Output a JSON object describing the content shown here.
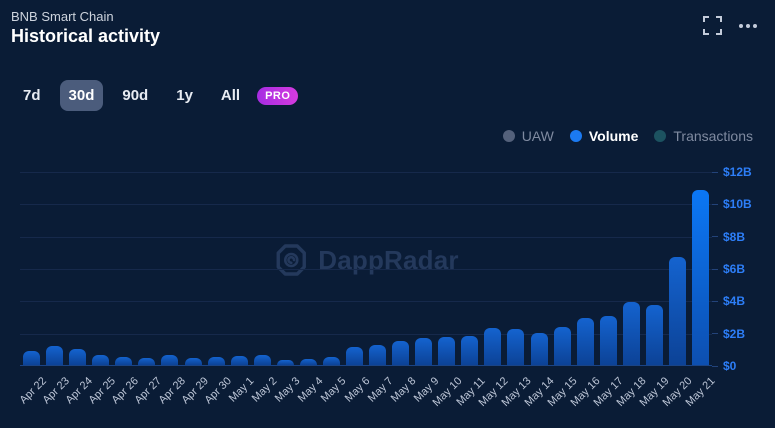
{
  "header": {
    "subtitle": "BNB Smart Chain",
    "title": "Historical activity"
  },
  "range_selector": {
    "options": [
      {
        "label": "7d",
        "active": false
      },
      {
        "label": "30d",
        "active": true
      },
      {
        "label": "90d",
        "active": false
      },
      {
        "label": "1y",
        "active": false
      },
      {
        "label": "All",
        "active": false
      }
    ],
    "pro_badge": "PRO"
  },
  "legend": [
    {
      "label": "UAW",
      "dot_color": "#54617b",
      "text_color": "#7f8aa0",
      "bold": false
    },
    {
      "label": "Volume",
      "dot_color": "#1b7af2",
      "text_color": "#ffffff",
      "bold": true
    },
    {
      "label": "Transactions",
      "dot_color": "#1c5260",
      "text_color": "#7f8aa0",
      "bold": false
    }
  ],
  "watermark": "DappRadar",
  "chart_data": {
    "type": "bar",
    "title": "Historical activity",
    "series_name": "Volume",
    "unit": "USD billions",
    "categories": [
      "Apr 22",
      "Apr 23",
      "Apr 24",
      "Apr 25",
      "Apr 26",
      "Apr 27",
      "Apr 28",
      "Apr 29",
      "Apr 30",
      "May 1",
      "May 2",
      "May 3",
      "May 4",
      "May 5",
      "May 6",
      "May 7",
      "May 8",
      "May 9",
      "May 10",
      "May 11",
      "May 12",
      "May 13",
      "May 14",
      "May 15",
      "May 16",
      "May 17",
      "May 18",
      "May 19",
      "May 20",
      "May 21"
    ],
    "values": [
      0.85,
      1.2,
      1.0,
      0.63,
      0.48,
      0.45,
      0.63,
      0.42,
      0.52,
      0.58,
      0.62,
      0.3,
      0.35,
      0.52,
      1.1,
      1.25,
      1.5,
      1.7,
      1.75,
      1.8,
      2.3,
      2.2,
      1.95,
      2.35,
      2.9,
      3.05,
      3.9,
      3.7,
      6.7,
      10.8
    ],
    "y_ticks": [
      "$12B",
      "$10B",
      "$8B",
      "$6B",
      "$4B",
      "$2B",
      "$0"
    ],
    "y_tick_values": [
      12,
      10,
      8,
      6,
      4,
      2,
      0
    ],
    "ylim": [
      0,
      12
    ],
    "grid": true,
    "legend_position": "top-right",
    "bar_color": "#0e51ae",
    "highlight_last_bar_color": "#0b77f5",
    "axis_label_color": "#2d7ef8"
  },
  "colors": {
    "background": "#0a1c36",
    "active_range_bg": "#4b5c7c",
    "pro_badge_bg": "#c42fd9",
    "gridline": "#16294b"
  }
}
